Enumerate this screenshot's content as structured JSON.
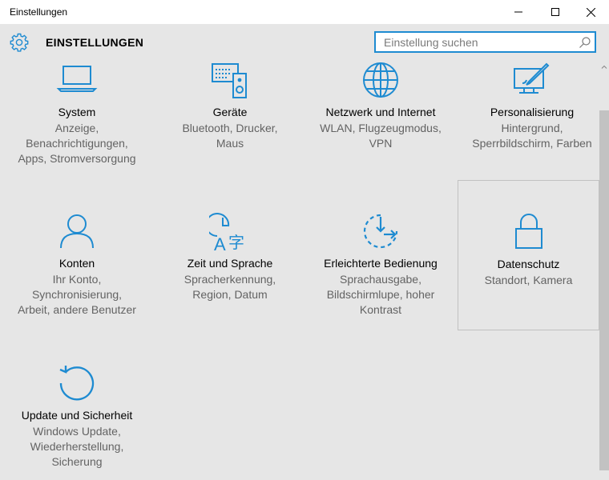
{
  "window": {
    "title": "Einstellungen"
  },
  "header": {
    "title": "EINSTELLUNGEN",
    "search_placeholder": "Einstellung suchen"
  },
  "colors": {
    "accent": "#1e8bd1",
    "background": "#e6e6e6",
    "secondary_text": "#636363"
  },
  "tiles": [
    {
      "icon": "laptop-icon",
      "name": "System",
      "desc": [
        "Anzeige,",
        "Benachrichtigungen,",
        "Apps, Stromversorgung"
      ]
    },
    {
      "icon": "devices-icon",
      "name": "Geräte",
      "desc": [
        "Bluetooth, Drucker,",
        "Maus"
      ]
    },
    {
      "icon": "globe-icon",
      "name": "Netzwerk und Internet",
      "desc": [
        "WLAN, Flugzeugmodus,",
        "VPN"
      ]
    },
    {
      "icon": "personalization-icon",
      "name": "Personalisierung",
      "desc": [
        "Hintergrund,",
        "Sperrbildschirm, Farben"
      ]
    },
    {
      "icon": "person-icon",
      "name": "Konten",
      "desc": [
        "Ihr Konto,",
        "Synchronisierung,",
        "Arbeit, andere Benutzer"
      ]
    },
    {
      "icon": "time-language-icon",
      "name": "Zeit und Sprache",
      "desc": [
        "Spracherkennung,",
        "Region, Datum"
      ]
    },
    {
      "icon": "ease-of-access-icon",
      "name": "Erleichterte Bedienung",
      "desc": [
        "Sprachausgabe,",
        "Bildschirmlupe, hoher",
        "Kontrast"
      ]
    },
    {
      "icon": "lock-icon",
      "name": "Datenschutz",
      "desc": [
        "Standort, Kamera"
      ]
    },
    {
      "icon": "update-icon",
      "name": "Update und Sicherheit",
      "desc": [
        "Windows Update,",
        "Wiederherstellung,",
        "Sicherung"
      ]
    }
  ]
}
